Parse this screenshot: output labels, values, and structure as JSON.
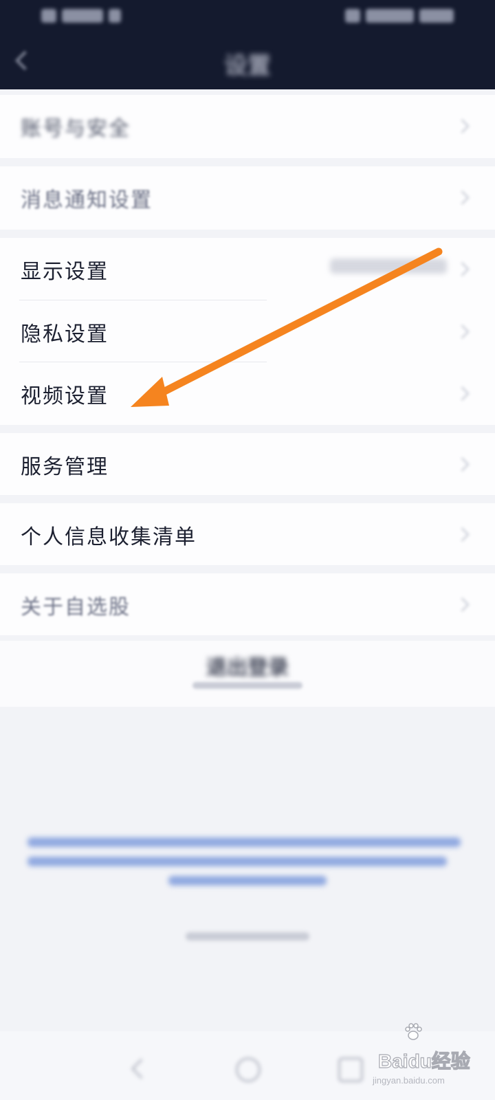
{
  "header": {
    "title": "设置"
  },
  "settings": {
    "account_security": "账号与安全",
    "notification": "消息通知设置",
    "display": "显示设置",
    "privacy": "隐私设置",
    "video": "视频设置",
    "service": "服务管理",
    "personal_info": "个人信息收集清单",
    "about": "关于自选股"
  },
  "logout": {
    "label": "退出登录"
  },
  "watermark": {
    "brand": "Baidu经验",
    "url": "jingyan.baidu.com"
  },
  "colors": {
    "header_bg": "#141a2e",
    "arrow": "#f5841f",
    "page_bg": "#f2f3f7"
  },
  "icons": [
    "back-icon",
    "chevron-right-icon",
    "annotation-arrow-icon",
    "baidu-paw-icon"
  ]
}
